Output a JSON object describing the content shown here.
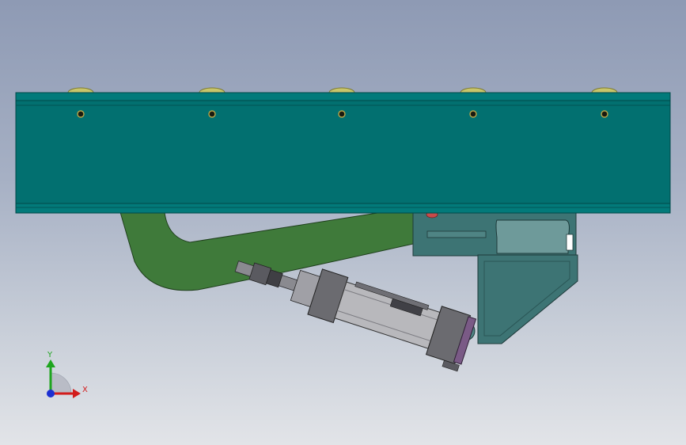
{
  "view": {
    "background_top": "#8e9ab4",
    "background_bottom": "#e2e4e8"
  },
  "model": {
    "beam_color": "#027070",
    "beam_edge_color": "#015757",
    "arm_color": "#3f7a3a",
    "bracket_color": "#3d7474",
    "cylinder_color": "#b8b8bc",
    "end_cap_color": "#6b6b70",
    "end_plate_color": "#7a5a86",
    "roller_color": "#c8c56a"
  },
  "triad": {
    "x_label": "X",
    "y_label": "Y",
    "x_color": "#d21c1c",
    "y_color": "#1ea51e",
    "z_color": "#1c2fd2"
  }
}
